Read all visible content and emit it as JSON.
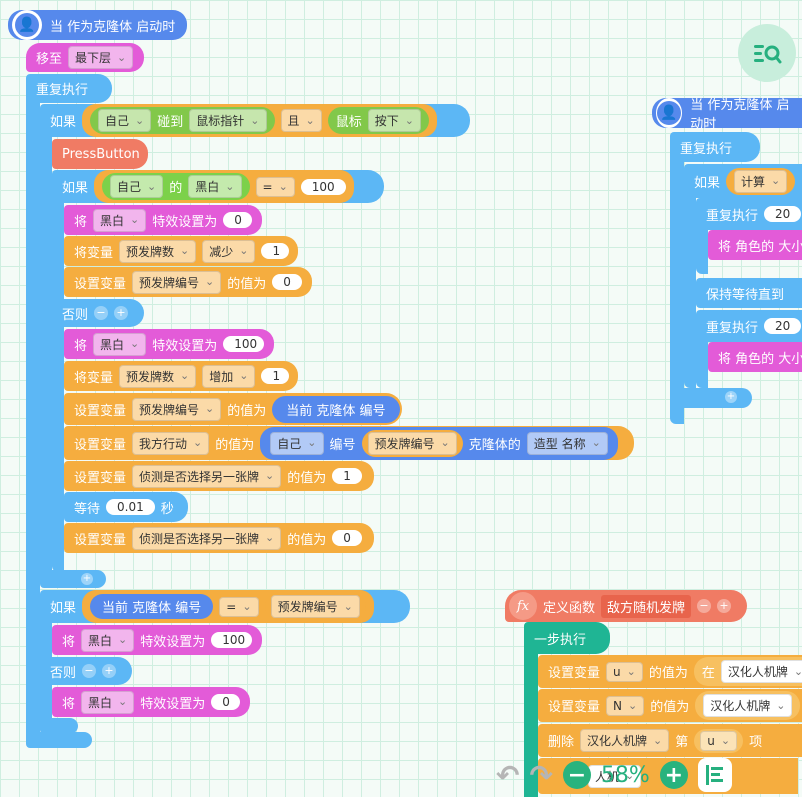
{
  "script1": {
    "hat": "当 作为克隆体 启动时",
    "move_to": "移至",
    "move_layer": "最下层",
    "repeat": "重复执行",
    "if1": {
      "label": "如果",
      "self": "自己",
      "touch": "碰到",
      "target": "鼠标指针",
      "and": "且",
      "mouse": "鼠标",
      "state": "按下"
    },
    "pressbutton": "PressButton",
    "if2": {
      "label": "如果",
      "self": "自己",
      "of": "的",
      "prop": "黑白",
      "op": "=",
      "value": "100"
    },
    "set_effect_1": {
      "a": "将",
      "effect": "黑白",
      "b": "特效设置为",
      "value": "0"
    },
    "change_var_1": {
      "a": "将变量",
      "var": "预发牌数",
      "op": "减少",
      "value": "1"
    },
    "set_var_1": {
      "a": "设置变量",
      "var": "预发牌编号",
      "b": "的值为",
      "value": "0"
    },
    "else1": "否则",
    "set_effect_2": {
      "a": "将",
      "effect": "黑白",
      "b": "特效设置为",
      "value": "100"
    },
    "change_var_2": {
      "a": "将变量",
      "var": "预发牌数",
      "op": "增加",
      "value": "1"
    },
    "set_var_2": {
      "a": "设置变量",
      "var": "预发牌编号",
      "b": "的值为",
      "value": "当前 克隆体 编号"
    },
    "set_var_3": {
      "a": "设置变量",
      "var": "我方行动",
      "b": "的值为",
      "self": "自己",
      "num": "编号",
      "var2": "预发牌编号",
      "clone": "克隆体的",
      "prop": "造型 名称"
    },
    "set_var_4": {
      "a": "设置变量",
      "var": "侦测是否选择另一张牌",
      "b": "的值为",
      "value": "1"
    },
    "wait": {
      "a": "等待",
      "value": "0.01",
      "b": "秒"
    },
    "set_var_5": {
      "a": "设置变量",
      "var": "侦测是否选择另一张牌",
      "b": "的值为",
      "value": "0"
    },
    "if3": {
      "label": "如果",
      "left": "当前 克隆体 编号",
      "op": "=",
      "right": "预发牌编号"
    },
    "set_effect_3": {
      "a": "将",
      "effect": "黑白",
      "b": "特效设置为",
      "value": "100"
    },
    "else2": "否则",
    "set_effect_4": {
      "a": "将",
      "effect": "黑白",
      "b": "特效设置为",
      "value": "0"
    }
  },
  "script2": {
    "hat": "当 作为克隆体 启动时",
    "repeat": "重复执行",
    "if": "如果",
    "calc": "计算",
    "repeat_n1": "重复执行",
    "n1": "20",
    "set_size_1": "将 角色的 大小",
    "wait_until": "保持等待直到",
    "repeat_n2": "重复执行",
    "n2": "20",
    "set_size_2": "将 角色的 大小"
  },
  "script3": {
    "define": "定义函数",
    "name": "敌方随机发牌",
    "step": "一步执行",
    "row1": {
      "a": "设置变量",
      "var": "u",
      "b": "的值为",
      "c": "在",
      "d": "汉化人机牌"
    },
    "row2": {
      "a": "设置变量",
      "var": "N",
      "b": "的值为",
      "d": "汉化人机牌"
    },
    "row3": {
      "a": "删除",
      "list": "汉化人机牌",
      "b": "第",
      "var": "u",
      "c": "项"
    },
    "row4": {
      "a": "人机"
    }
  },
  "toolbar": {
    "zoom": "58%"
  }
}
